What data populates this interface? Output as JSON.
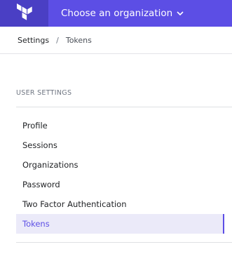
{
  "header": {
    "logo_icon": "terraform-logo-icon",
    "org_switcher_label": "Choose an organization",
    "org_switcher_icon": "chevron-down-icon",
    "colors": {
      "bar": "#5c4ee5",
      "logo_bg": "#4a3fc4"
    }
  },
  "breadcrumb": {
    "parent": "Settings",
    "separator": "/",
    "current": "Tokens"
  },
  "sidebar": {
    "heading": "USER SETTINGS",
    "items": [
      {
        "label": "Profile",
        "active": false
      },
      {
        "label": "Sessions",
        "active": false
      },
      {
        "label": "Organizations",
        "active": false
      },
      {
        "label": "Password",
        "active": false
      },
      {
        "label": "Two Factor Authentication",
        "active": false
      },
      {
        "label": "Tokens",
        "active": true
      }
    ],
    "colors": {
      "active_bg": "#ebeaf9",
      "active_text": "#5c4ee5"
    }
  }
}
